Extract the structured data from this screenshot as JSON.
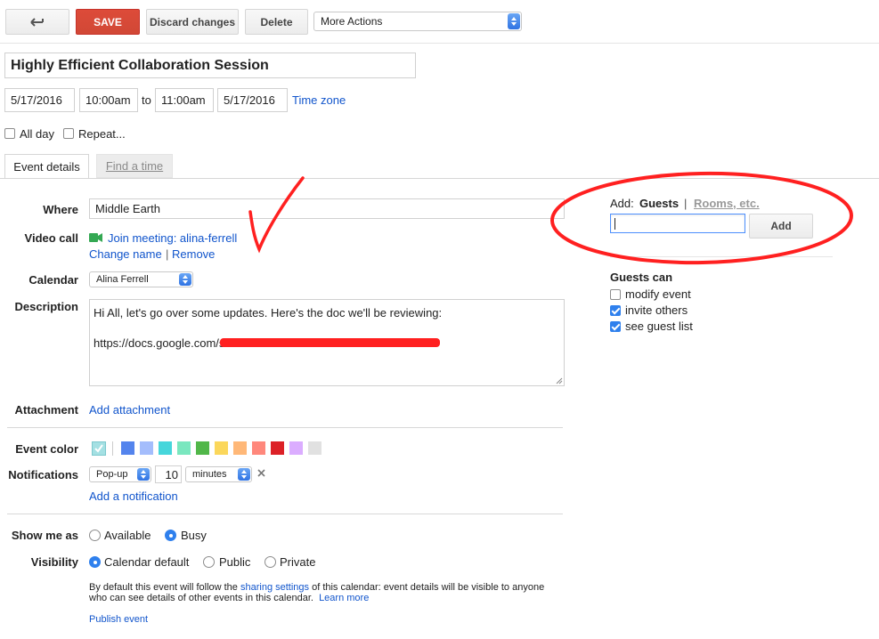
{
  "toolbar": {
    "back_icon": "back-arrow-icon",
    "save_label": "SAVE",
    "discard_label": "Discard changes",
    "delete_label": "Delete",
    "more_actions_label": "More Actions"
  },
  "event": {
    "title": "Highly Efficient Collaboration Session",
    "start_date": "5/17/2016",
    "start_time": "10:00am",
    "to_label": "to",
    "end_time": "11:00am",
    "end_date": "5/17/2016",
    "timezone_link": "Time zone",
    "allday_label": "All day",
    "repeat_label": "Repeat..."
  },
  "tabs": [
    {
      "label": "Event details"
    },
    {
      "label": "Find a time"
    }
  ],
  "details": {
    "where_label": "Where",
    "where_value": "Middle Earth",
    "video_label": "Video call",
    "video_link": "Join meeting: alina-ferrell",
    "change_name": "Change name",
    "separator": "|",
    "remove": "Remove",
    "calendar_label": "Calendar",
    "calendar_value": "Alina Ferrell",
    "description_label": "Description",
    "description_line1": "Hi All, let's go over some updates. Here's the doc we'll be reviewing:",
    "description_line2": "https://docs.google.com/s",
    "attachment_label": "Attachment",
    "add_attachment": "Add attachment",
    "color_label": "Event color",
    "notifications_label": "Notifications",
    "notif_type": "Pop-up",
    "notif_value": "10",
    "notif_unit": "minutes",
    "notif_remove_icon": "close-icon",
    "add_notification": "Add a notification",
    "show_me_as_label": "Show me as",
    "available_label": "Available",
    "busy_label": "Busy",
    "visibility_label": "Visibility",
    "calendar_default_label": "Calendar default",
    "public_label": "Public",
    "private_label": "Private",
    "visibility_note_1": "By default this event will follow the ",
    "sharing_settings": "sharing settings",
    "visibility_note_2": " of this calendar: event details will be visible to anyone",
    "visibility_note_3": "who can see details of other events in this calendar.",
    "learn_more": "Learn more",
    "publish_event": "Publish event"
  },
  "colors": {
    "swatches": [
      "#a4e0e3",
      "#5484ed",
      "#a4bdfc",
      "#46d6db",
      "#7ae7bf",
      "#51b749",
      "#fbd75b",
      "#ffb878",
      "#ff887c",
      "#dc2127",
      "#dbadff",
      "#e1e1e1"
    ],
    "annotation_red": "#ff2020",
    "link_blue": "#1155cc",
    "save_red": "#d14836"
  },
  "guests": {
    "add_label": "Add:",
    "guests_tab": "Guests",
    "separator": "|",
    "rooms_tab": "Rooms, etc.",
    "input_value": "",
    "add_button": "Add",
    "guests_can_label": "Guests can",
    "options": [
      {
        "label": "modify event",
        "checked": false
      },
      {
        "label": "invite others",
        "checked": true
      },
      {
        "label": "see guest list",
        "checked": true
      }
    ]
  }
}
